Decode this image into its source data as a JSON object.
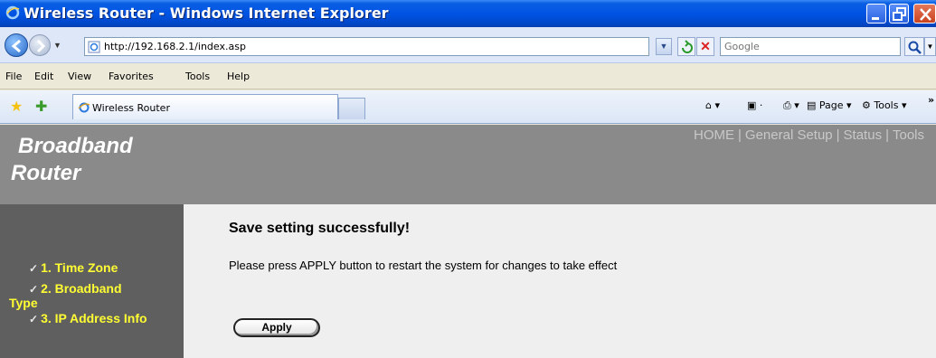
{
  "window": {
    "title": "Wireless Router - Windows Internet Explorer"
  },
  "address_bar": {
    "url": "http://192.168.2.1/index.asp",
    "search_placeholder": "Google"
  },
  "menu": {
    "items": [
      "File",
      "Edit",
      "View",
      "Favorites",
      "Tools",
      "Help"
    ]
  },
  "tabs": {
    "active_tab_label": "Wireless Router"
  },
  "command_bar": {
    "page_label": "Page",
    "tools_label": "Tools",
    "overflow": "»"
  },
  "router_page": {
    "brand_line1": "Broadband",
    "brand_line2": "Router",
    "top_nav": [
      "HOME",
      "General Setup",
      "Status",
      "Tools"
    ],
    "sidebar": {
      "items": [
        {
          "label": "1. Time Zone"
        },
        {
          "label": "2. Broadband",
          "continuation": "Type"
        },
        {
          "label": "3. IP Address Info"
        }
      ]
    },
    "message_title": "Save setting successfully!",
    "message_body": "Please press APPLY button to restart the system for changes to take effect",
    "apply_label": "Apply"
  },
  "colors": {
    "titlebar": "#0054e3",
    "header_bg": "#8a8a8a",
    "sidebar_bg": "#5f5f5f",
    "sidebar_text": "#ffff33",
    "content_bg": "#efefef"
  }
}
